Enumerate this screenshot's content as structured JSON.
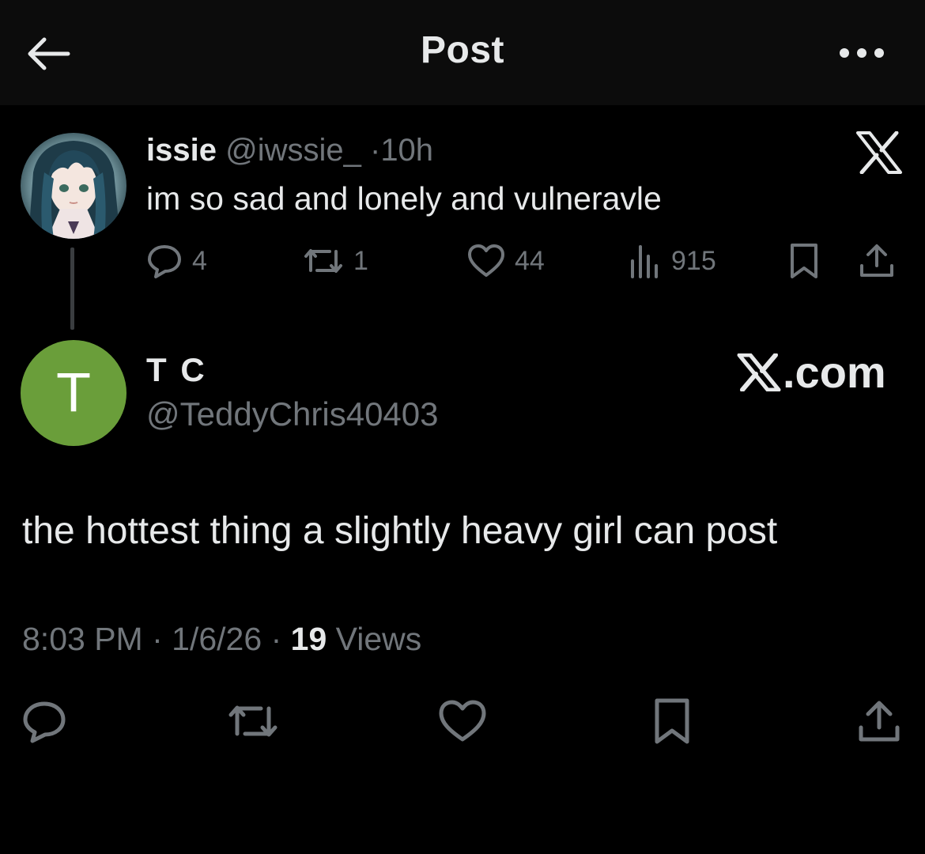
{
  "header": {
    "title": "Post",
    "back_icon": "arrow-left-icon",
    "more_icon": "more-horizontal-icon"
  },
  "quoted_post": {
    "display_name": "issie",
    "handle": "@iwssie_",
    "separator": "·",
    "time_ago": "10h",
    "text": "im so sad and lonely and vulneravle",
    "replies": "4",
    "reposts": "1",
    "likes": "44",
    "views": "915",
    "source_logo": "x-logo-icon"
  },
  "post": {
    "display_name": "T C",
    "avatar_initial": "T",
    "avatar_color": "#6a9e3a",
    "handle": "@TeddyChris40403",
    "watermark": ".com",
    "text": "the hottest thing a slightly heavy girl can post",
    "time": "8:03 PM",
    "date": "1/6/26",
    "separator": "·",
    "views_count": "19",
    "views_label": "Views"
  },
  "colors": {
    "background": "#000000",
    "header_background": "#0c0c0c",
    "text_primary": "#e7e9ea",
    "text_muted": "#71767b",
    "thread_line": "#3a3d40"
  }
}
